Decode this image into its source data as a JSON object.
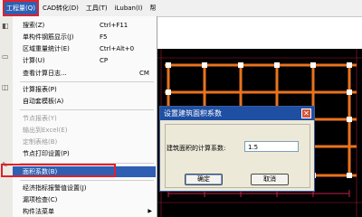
{
  "menubar": {
    "items": [
      "工程量(Q)",
      "CAD转化(D)",
      "工具(T)",
      "iLuban(I)",
      "帮"
    ]
  },
  "menu": {
    "items": [
      {
        "label": "搜索(Z)",
        "shortcut": "Ctrl+F11",
        "disabled": false,
        "icon": "search-icon"
      },
      {
        "label": "单构件钢筋显示(J)",
        "shortcut": "F5",
        "disabled": false,
        "icon": "rebar-icon"
      },
      {
        "label": "区域重量统计(E)",
        "shortcut": "Ctrl+Alt+0",
        "disabled": false,
        "icon": "region-icon"
      },
      {
        "label": "计算(U)",
        "shortcut": "CP",
        "disabled": false,
        "icon": "calc-icon"
      },
      {
        "label": "查看计算日志...",
        "shortcut": "CM",
        "disabled": false,
        "icon": ""
      },
      {
        "label": "计算报表(P)",
        "shortcut": "",
        "disabled": false,
        "icon": "report-icon"
      },
      {
        "label": "自动套模板(A)",
        "shortcut": "",
        "disabled": false,
        "icon": ""
      },
      {
        "label": "节点报表(Y)",
        "shortcut": "",
        "disabled": true,
        "icon": ""
      },
      {
        "label": "输出到Excel(E)",
        "shortcut": "",
        "disabled": true,
        "icon": ""
      },
      {
        "label": "定制表格(B)",
        "shortcut": "",
        "disabled": true,
        "icon": ""
      },
      {
        "label": "节点打印设置(P)",
        "shortcut": "",
        "disabled": false,
        "icon": ""
      },
      {
        "label": "面积系数(B)",
        "shortcut": "",
        "disabled": false,
        "icon": "area-icon"
      },
      {
        "label": "经济指标报警值设置(J)",
        "shortcut": "",
        "disabled": false,
        "icon": ""
      },
      {
        "label": "漏项检查(C)",
        "shortcut": "",
        "disabled": false,
        "icon": ""
      },
      {
        "label": "构件法菜单",
        "shortcut": "",
        "disabled": false,
        "icon": "",
        "submenu": true
      }
    ]
  },
  "dialog": {
    "title": "设置建筑面积系数",
    "field_label": "建筑面积的计算系数:",
    "field_value": "1.5",
    "ok_label": "确定",
    "cancel_label": "取消"
  },
  "colors": {
    "accent": "#2f5fb3",
    "highlight": "#e0202a",
    "beam": "#e8731e",
    "grid": "#c8204a"
  }
}
